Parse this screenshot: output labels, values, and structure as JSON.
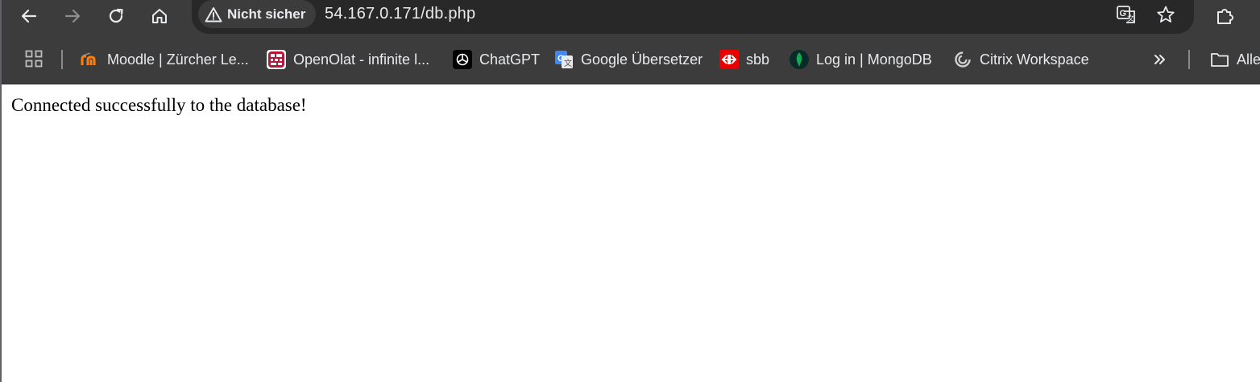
{
  "toolbar": {
    "back_icon": "arrow-left-icon",
    "forward_icon": "arrow-right-icon",
    "reload_icon": "reload-icon",
    "home_icon": "home-icon"
  },
  "omnibox": {
    "security_label": "Nicht sicher",
    "url": "54.167.0.171/db.php",
    "translate_icon": "translate-icon",
    "bookmark_icon": "star-icon"
  },
  "extensions_icon": "puzzle-icon",
  "bookmarks": {
    "items": [
      {
        "label": "Moodle | Zürcher Le...",
        "icon": "moodle-icon"
      },
      {
        "label": "OpenOlat - infinite l...",
        "icon": "openolat-icon"
      },
      {
        "label": "ChatGPT",
        "icon": "chatgpt-icon"
      },
      {
        "label": "Google Übersetzer",
        "icon": "google-translate-icon"
      },
      {
        "label": "sbb",
        "icon": "sbb-icon"
      },
      {
        "label": "Log in | MongoDB",
        "icon": "mongodb-icon"
      },
      {
        "label": "Citrix Workspace",
        "icon": "citrix-icon"
      }
    ],
    "overflow_icon": "double-chevron-right-icon",
    "folder_label": "Alle",
    "folder_icon": "folder-icon"
  },
  "page": {
    "message": "Connected successfully to the database!"
  },
  "colors": {
    "chrome_dark": "#3c3c3c",
    "omnibox_bg": "#282828",
    "text_light": "#e8eaed"
  }
}
